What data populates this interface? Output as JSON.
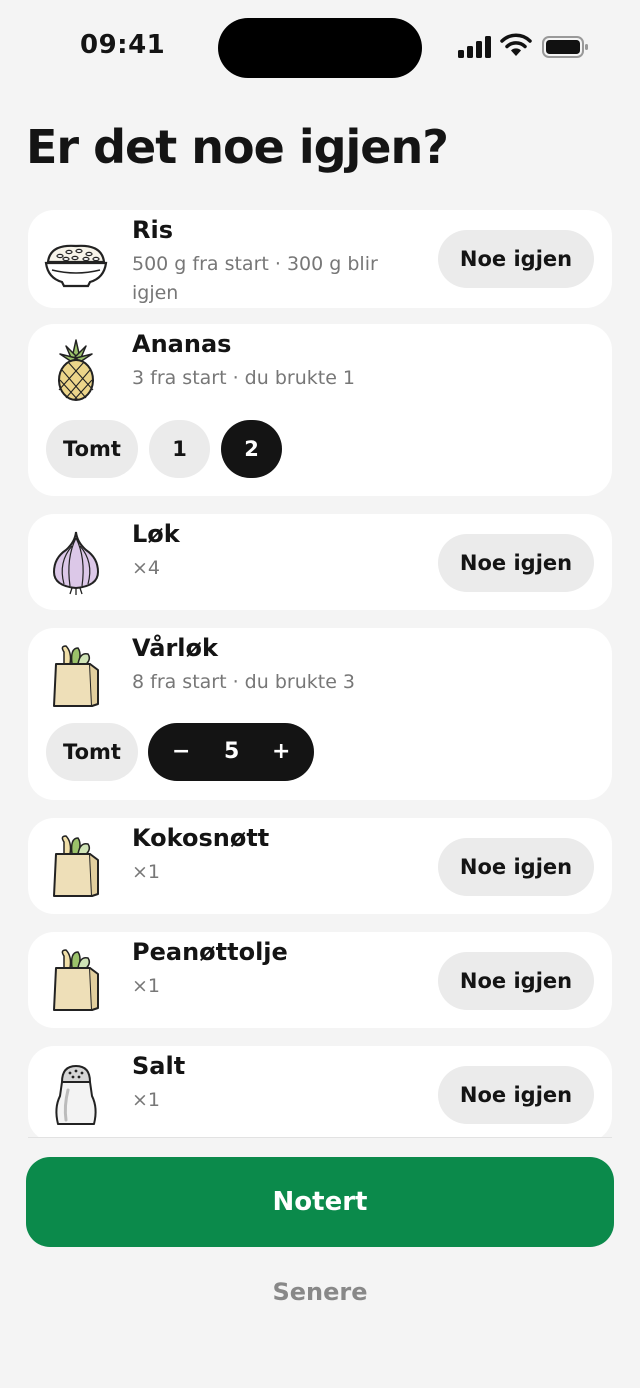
{
  "status": {
    "time": "09:41"
  },
  "title": "Er det noe igjen?",
  "items": [
    {
      "name": "Ris",
      "detail": "500 g fra start · 300 g blir igjen",
      "action": "Noe igjen",
      "icon": "rice-bowl-icon"
    },
    {
      "name": "Ananas",
      "detail": "3 fra start · du brukte 1",
      "options": [
        "Tomt",
        "1",
        "2"
      ],
      "selected": "2",
      "icon": "pineapple-icon"
    },
    {
      "name": "Løk",
      "detail": "×4",
      "action": "Noe igjen",
      "icon": "onion-icon"
    },
    {
      "name": "Vårløk",
      "detail": "8 fra start · du brukte 3",
      "empty_label": "Tomt",
      "stepper": {
        "minus": "−",
        "value": "5",
        "plus": "+"
      },
      "icon": "grocery-bag-icon"
    },
    {
      "name": "Kokosnøtt",
      "detail": "×1",
      "action": "Noe igjen",
      "icon": "grocery-bag-icon"
    },
    {
      "name": "Peanøttolje",
      "detail": "×1",
      "action": "Noe igjen",
      "icon": "grocery-bag-icon"
    },
    {
      "name": "Salt",
      "detail": "×1",
      "action": "Noe igjen",
      "icon": "salt-shaker-icon"
    }
  ],
  "buttons": {
    "primary": "Notert",
    "secondary": "Senere"
  },
  "colors": {
    "accent": "#0b8a4b",
    "dark": "#141414",
    "background": "#f4f4f4"
  }
}
